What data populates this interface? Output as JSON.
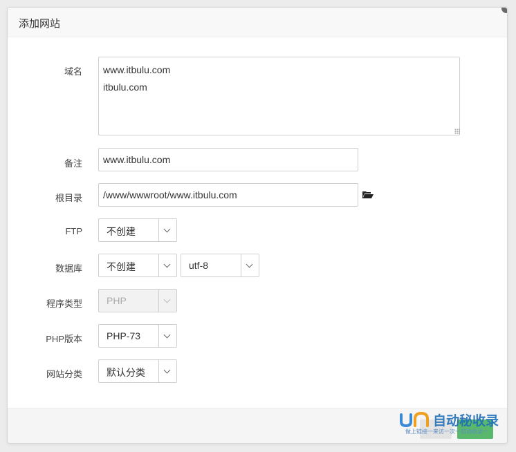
{
  "dialog": {
    "title": "添加网站"
  },
  "form": {
    "domain": {
      "label": "域名",
      "value": "www.itbulu.com\nitbulu.com"
    },
    "remark": {
      "label": "备注",
      "value": "www.itbulu.com"
    },
    "root_dir": {
      "label": "根目录",
      "value": "/www/wwwroot/www.itbulu.com"
    },
    "ftp": {
      "label": "FTP",
      "selected": "不创建"
    },
    "database": {
      "label": "数据库",
      "selected": "不创建",
      "charset_selected": "utf-8"
    },
    "program_type": {
      "label": "程序类型",
      "selected": "PHP",
      "disabled": true
    },
    "php_version": {
      "label": "PHP版本",
      "selected": "PHP-73"
    },
    "site_category": {
      "label": "网站分类",
      "selected": "默认分类"
    }
  },
  "watermark": {
    "title": "自动秘收录",
    "subtitle": "做上链接一来访一次一自动收录一"
  },
  "colors": {
    "accent_green": "#5ab86c",
    "watermark_blue": "#1f6fb8"
  }
}
